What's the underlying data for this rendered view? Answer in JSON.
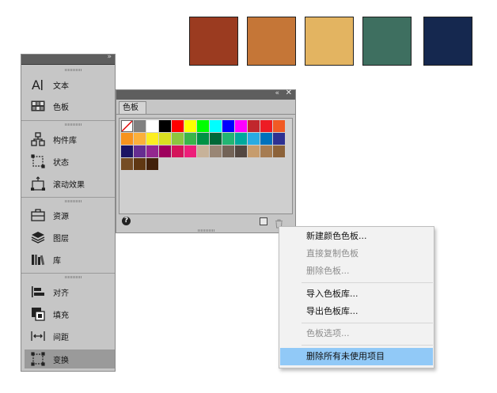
{
  "top_swatches": [
    "#9b3b20",
    "#c57637",
    "#e3b461",
    "#3e6f60",
    "#15284f"
  ],
  "dock": {
    "collapse_glyph": "»",
    "items": [
      {
        "label": "文本",
        "icon": "text-tool-icon"
      },
      {
        "label": "色板",
        "icon": "swatches-icon"
      },
      {
        "label": "构件库",
        "icon": "components-library-icon"
      },
      {
        "label": "状态",
        "icon": "states-icon"
      },
      {
        "label": "滚动效果",
        "icon": "scroll-effects-icon"
      },
      {
        "label": "资源",
        "icon": "assets-icon"
      },
      {
        "label": "图层",
        "icon": "layers-icon"
      },
      {
        "label": "库",
        "icon": "library-icon"
      },
      {
        "label": "对齐",
        "icon": "align-icon"
      },
      {
        "label": "填充",
        "icon": "fill-icon"
      },
      {
        "label": "间距",
        "icon": "spacing-icon"
      },
      {
        "label": "变换",
        "icon": "transform-icon"
      }
    ]
  },
  "swatch_panel": {
    "collapse_glyph": "«",
    "close_glyph": "✕",
    "tab_label": "色板",
    "help_glyph": "?",
    "rows": [
      [
        "none",
        "#808080",
        "#ffffff",
        "#000000",
        "#ff0000",
        "#ffff00",
        "#00ff00",
        "#00ffff",
        "#0000ff",
        "#ff00ff",
        "#c1272d",
        "#ed1c24",
        "#f15a24"
      ],
      [
        "#f7931e",
        "#fbb03b",
        "#fcee21",
        "#d9e021",
        "#8cc63f",
        "#39b54a",
        "#009245",
        "#006837",
        "#22b573",
        "#00a99d",
        "#29abe2",
        "#0071bc",
        "#2e3192"
      ],
      [
        "#1b1464",
        "#662d91",
        "#93278f",
        "#9e005d",
        "#d4145a",
        "#ed1e79",
        "#c7b299",
        "#998675",
        "#736357",
        "#534741",
        "#c69c6d",
        "#a67c52",
        "#8c6239"
      ],
      [
        "#754c24",
        "#603813",
        "#42210b"
      ]
    ]
  },
  "menu": {
    "items": [
      {
        "label": "新建颜色色板...",
        "enabled": true
      },
      {
        "label": "直接复制色板",
        "enabled": false
      },
      {
        "label": "删除色板...",
        "enabled": false
      },
      {
        "label": "导入色板库...",
        "enabled": true
      },
      {
        "label": "导出色板库...",
        "enabled": true
      },
      {
        "label": "色板选项...",
        "enabled": false
      },
      {
        "label": "删除所有未使用项目",
        "enabled": true,
        "highlighted": true
      }
    ]
  }
}
